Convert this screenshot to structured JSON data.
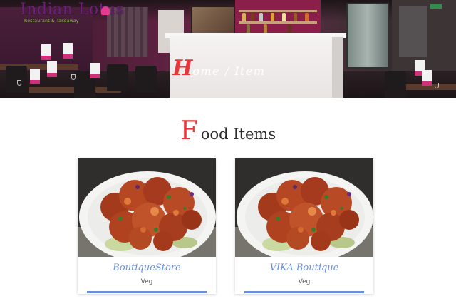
{
  "header": {
    "brand_name": "Indian Lotus",
    "brand_tagline": "Restaurant & Takeaway",
    "breadcrumb_initial": "H",
    "breadcrumb_rest": "ome / Item"
  },
  "section": {
    "title_initial": "F",
    "title_rest": "ood Items"
  },
  "colors": {
    "accent": "#e8363a",
    "link": "#6a8fd8",
    "brand": "#6c1f7c"
  },
  "items": [
    {
      "name": "BoutiqueStore",
      "category": "Veg",
      "image": "tandoori-food-photo"
    },
    {
      "name": "VIKA Boutique",
      "category": "Veg",
      "image": "tandoori-food-photo"
    }
  ]
}
